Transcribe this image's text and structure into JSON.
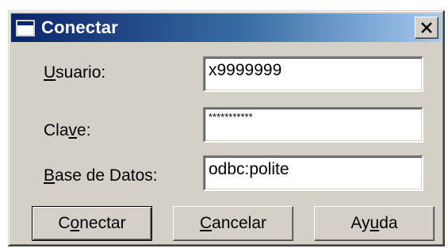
{
  "dialog": {
    "title": "Conectar",
    "close_symbol": "×",
    "icon": "window-icon"
  },
  "form": {
    "usuario": {
      "label_mnemonic": "U",
      "label_rest": "suario:",
      "value": "x9999999"
    },
    "clave": {
      "label_pre": "Cla",
      "label_mnemonic": "v",
      "label_post": "e:",
      "value": "***********"
    },
    "base_datos": {
      "label_mnemonic": "B",
      "label_rest": "ase de Datos:",
      "value": "odbc:polite"
    }
  },
  "buttons": {
    "conectar": {
      "pre": "C",
      "mnemonic": "o",
      "post": "nectar"
    },
    "cancelar": {
      "mnemonic": "C",
      "post": "ancelar"
    },
    "ayuda": {
      "pre": "Ay",
      "mnemonic": "u",
      "post": "da"
    }
  },
  "colors": {
    "title_gradient_start": "#0a246a",
    "title_gradient_end": "#a6caf0",
    "dialog_face": "#d4d0c8"
  }
}
